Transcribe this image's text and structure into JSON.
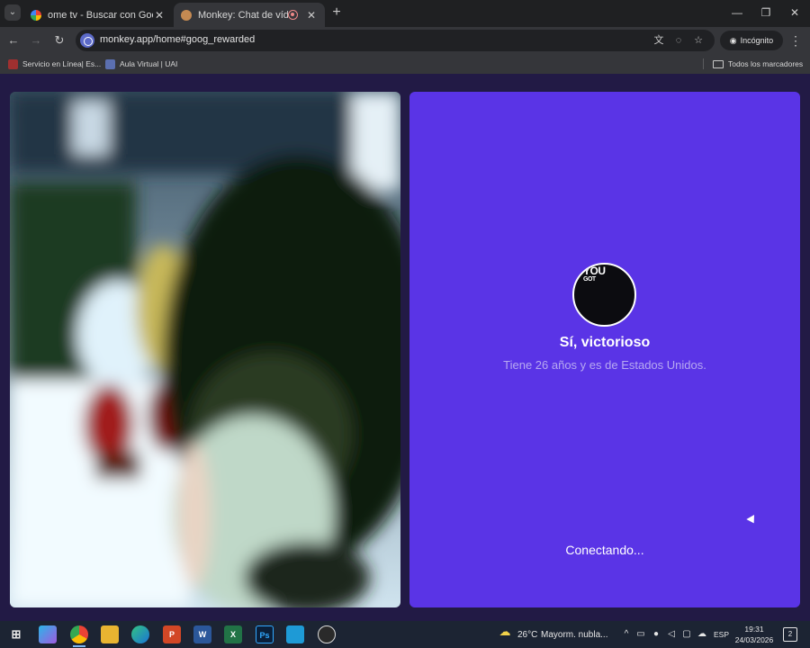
{
  "browser": {
    "tabs": [
      {
        "title": "ome tv - Buscar con Google",
        "active": false
      },
      {
        "title": "Monkey: Chat de vídeo en",
        "active": true
      }
    ],
    "url": "monkey.app/home#goog_rewarded",
    "incognito_label": "Incógnito",
    "bookmarks": [
      {
        "label": "Servicio en Línea| Es..."
      },
      {
        "label": "Aula Virtual | UAI"
      }
    ],
    "all_bookmarks_label": "Todos los marcadores"
  },
  "match": {
    "avatar_text_line1": "YOU",
    "avatar_text_line2": "GOT",
    "name": "Sí, victorioso",
    "subtitle": "Tiene 26 años y es de Estados Unidos.",
    "status": "Conectando..."
  },
  "taskbar": {
    "weather_temp": "26°C",
    "weather_desc": "Mayorm. nubla...",
    "language": "ESP",
    "time": "19:31",
    "date": "24/03/2026",
    "notification_count": "2"
  },
  "colors": {
    "page_bg": "#221a45",
    "match_panel": "#5a34e6",
    "subtitle": "#b7a9f1"
  }
}
